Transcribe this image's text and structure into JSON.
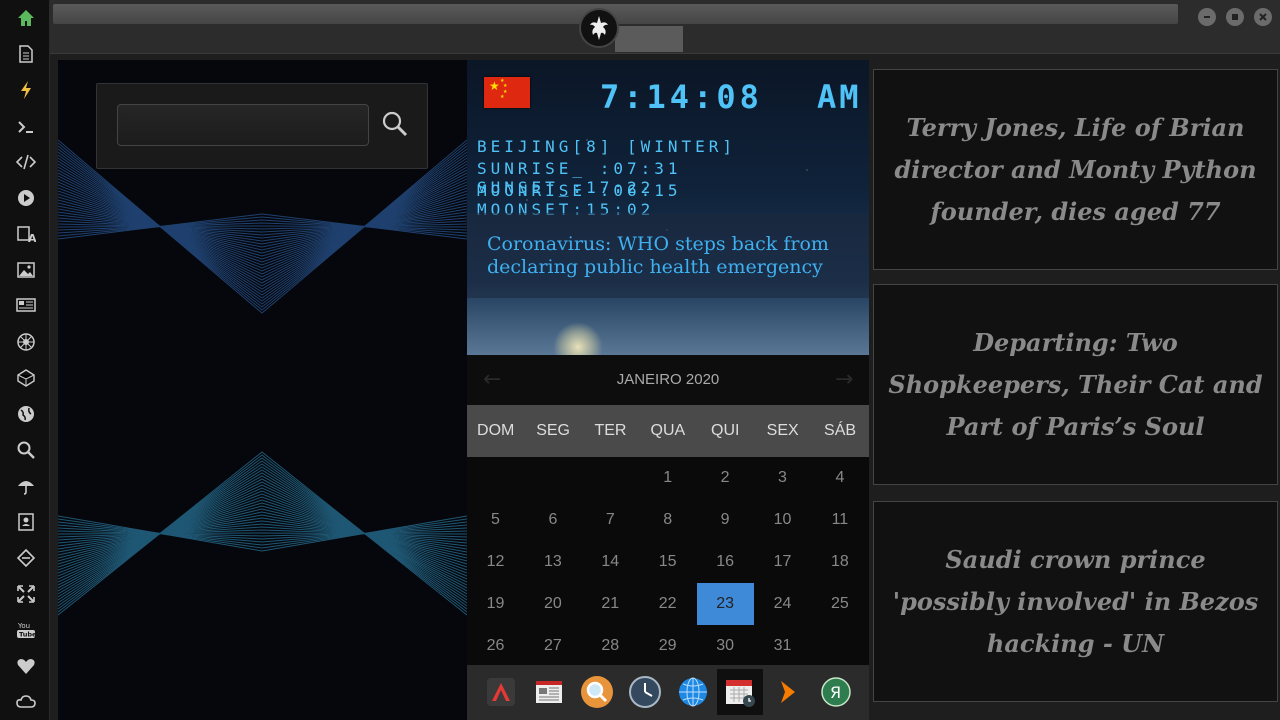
{
  "sidebar": {
    "icons": [
      "home-icon",
      "document-icon",
      "lightning-icon",
      "terminal-icon",
      "code-icon",
      "play-icon",
      "translate-icon",
      "image-icon",
      "news-icon",
      "rebel-icon",
      "cube-icon",
      "globe-icon",
      "search-icon",
      "umbrella-icon",
      "contacts-icon",
      "tag-icon",
      "expand-icon",
      "youtube-icon",
      "heart-icon",
      "cloud-icon"
    ],
    "youtube_label": "You Tube",
    "accent": "#5cb85c"
  },
  "search": {
    "value": "",
    "placeholder": ""
  },
  "clock": {
    "time": "7:14:08",
    "ampm": "AM",
    "location": "BEIJING[8] [WINTER]",
    "sun": "SUNRISE_ :07:31 SUNSET_:17:22",
    "moon": "MOONRISE :06:15 MOONSET:15:02",
    "headline": "Coronavirus: WHO steps back from declaring public health emergency"
  },
  "calendar": {
    "month": "JANEIRO 2020",
    "weekdays": [
      "DOM",
      "SEG",
      "TER",
      "QUA",
      "QUI",
      "SEX",
      "SÁB"
    ],
    "weeks": [
      [
        "",
        "",
        "",
        "1",
        "2",
        "3",
        "4"
      ],
      [
        "5",
        "6",
        "7",
        "8",
        "9",
        "10",
        "11"
      ],
      [
        "12",
        "13",
        "14",
        "15",
        "16",
        "17",
        "18"
      ],
      [
        "19",
        "20",
        "21",
        "22",
        "23",
        "24",
        "25"
      ],
      [
        "26",
        "27",
        "28",
        "29",
        "30",
        "31",
        ""
      ]
    ],
    "selected": "23"
  },
  "dock": [
    "launcher-icon",
    "newspaper-icon",
    "magnifier-icon",
    "clock-icon",
    "globe-icon",
    "calendar-icon",
    "arrow-icon",
    "yandex-icon"
  ],
  "news": [
    "Terry Jones, Life of Brian director and Monty Python founder, dies aged 77",
    "Departing: Two Shopkeepers, Their Cat and Part of Paris’s Soul",
    "Saudi crown prince 'possibly involved' in Bezos hacking - UN"
  ]
}
